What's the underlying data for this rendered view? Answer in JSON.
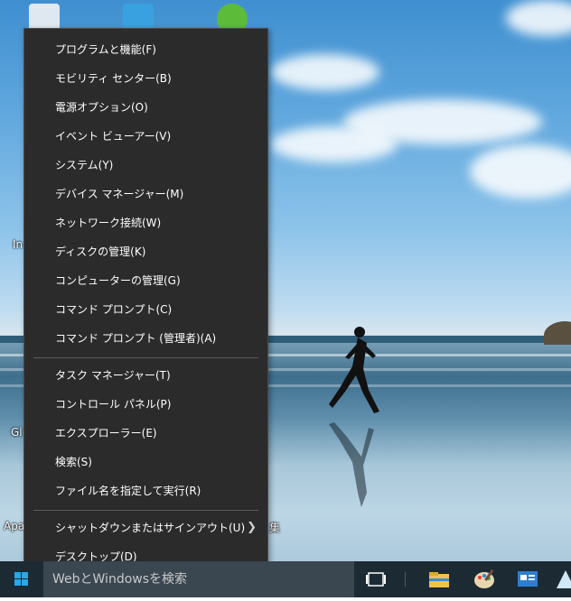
{
  "context_menu": {
    "items": [
      {
        "label": "プログラムと機能(F)"
      },
      {
        "label": "モビリティ センター(B)"
      },
      {
        "label": "電源オプション(O)"
      },
      {
        "label": "イベント ビューアー(V)"
      },
      {
        "label": "システム(Y)"
      },
      {
        "label": "デバイス マネージャー(M)"
      },
      {
        "label": "ネットワーク接続(W)"
      },
      {
        "label": "ディスクの管理(K)"
      },
      {
        "label": "コンピューターの管理(G)"
      },
      {
        "label": "コマンド プロンプト(C)"
      },
      {
        "label": "コマンド プロンプト (管理者)(A)"
      },
      {
        "label": "タスク マネージャー(T)"
      },
      {
        "label": "コントロール パネル(P)"
      },
      {
        "label": "エクスプローラー(E)"
      },
      {
        "label": "検索(S)"
      },
      {
        "label": "ファイル名を指定して実行(R)"
      },
      {
        "label": "シャットダウンまたはサインアウト(U)",
        "submenu_icon": "chevron-right-icon"
      },
      {
        "label": "デスクトップ(D)"
      }
    ]
  },
  "taskbar": {
    "search_placeholder": "WebとWindowsを検索",
    "icons": [
      "windows-start-icon",
      "task-view-icon",
      "file-explorer-icon",
      "paint-icon",
      "control-panel-icon",
      "app-icon"
    ]
  },
  "desktop": {
    "labels": [
      "In",
      "Gl",
      "Apa",
      "集"
    ]
  }
}
